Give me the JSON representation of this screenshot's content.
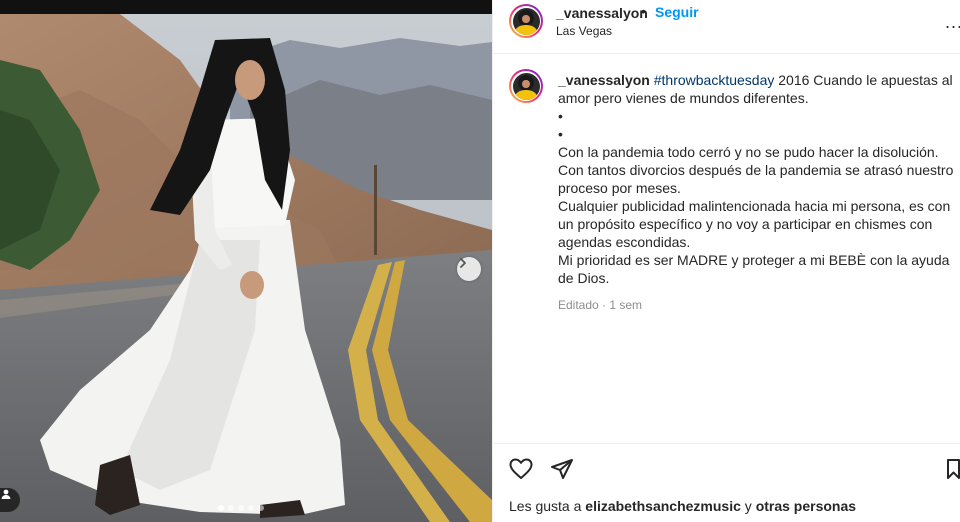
{
  "post": {
    "username": "_vanessalyon",
    "separator": "•",
    "follow_label": "Seguir",
    "location": "Las Vegas",
    "more_label": "..."
  },
  "caption": {
    "username": "_vanessalyon",
    "hashtag": "#throwbacktuesday",
    "line1_rest": " 2016 Cuando le apuestas al amor pero vienes de mundos diferentes.",
    "bullet1": "•",
    "bullet2": "•",
    "p1": "Con la pandemia todo cerró y no se pudo hacer la disolución.",
    "p2": "Con tantos divorcios después de la pandemia se atrasó nuestro proceso por meses.",
    "p3": "Cualquier publicidad malintencionada hacia mi persona, es con un propósito específico y no voy a participar en chismes con agendas escondidas.",
    "p4": "Mi prioridad es ser MADRE y proteger a mi BEBÈ con la ayuda de Dios.",
    "edited": "Editado · 1 sem"
  },
  "likes": {
    "prefix": "Les gusta a ",
    "user": "elizabethsanchezmusic",
    "middle": " y ",
    "others": "otras personas"
  },
  "icons": {
    "like": "heart-icon",
    "share": "send-icon",
    "save": "bookmark-icon",
    "next": "chevron-right-icon",
    "tags": "user-tag-icon"
  },
  "colors": {
    "accent": "#0095f6",
    "hashtag": "#00376b",
    "muted": "#8e8e8e"
  },
  "carousel": {
    "slides": 5,
    "active_slide": 1
  }
}
